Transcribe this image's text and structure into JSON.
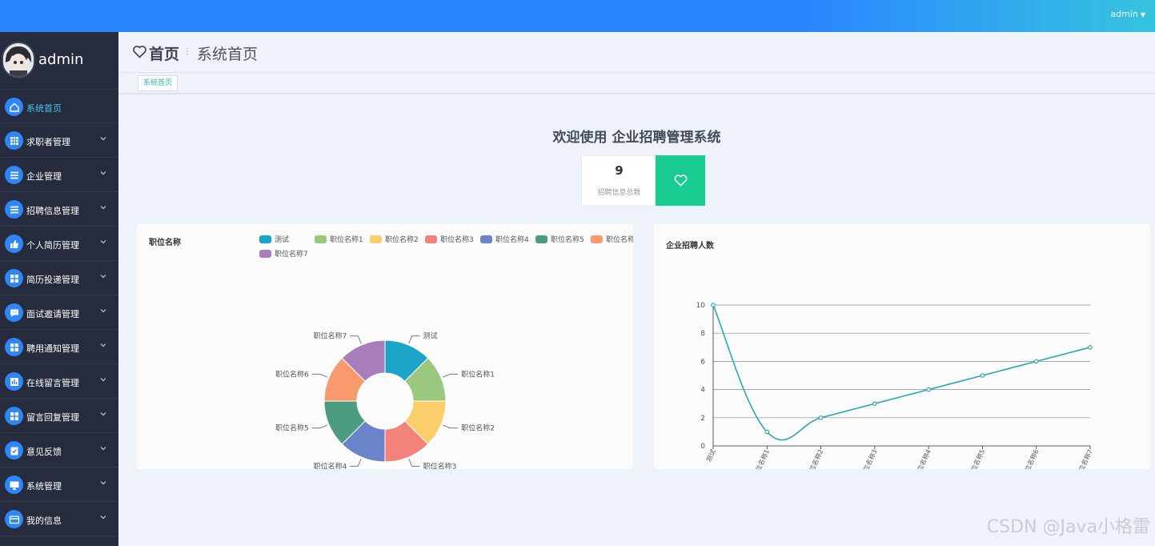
{
  "header": {
    "user": "admin"
  },
  "sidebar": {
    "username": "admin",
    "items": [
      {
        "label": "系统首页",
        "icon": "home-icon",
        "active": true,
        "has_arrow": false
      },
      {
        "label": "求职者管理",
        "icon": "grid-icon",
        "has_arrow": true
      },
      {
        "label": "企业管理",
        "icon": "list-icon",
        "has_arrow": true
      },
      {
        "label": "招聘信息管理",
        "icon": "list-icon",
        "has_arrow": true
      },
      {
        "label": "个人简历管理",
        "icon": "thumbs-up-icon",
        "has_arrow": true
      },
      {
        "label": "简历投递管理",
        "icon": "apps-icon",
        "has_arrow": true
      },
      {
        "label": "面试邀请管理",
        "icon": "message-icon",
        "has_arrow": true
      },
      {
        "label": "聘用通知管理",
        "icon": "apps-icon",
        "has_arrow": true
      },
      {
        "label": "在线留言管理",
        "icon": "chart-icon",
        "has_arrow": true
      },
      {
        "label": "留言回复管理",
        "icon": "apps-icon",
        "has_arrow": true
      },
      {
        "label": "意见反馈",
        "icon": "clipboard-icon",
        "has_arrow": true
      },
      {
        "label": "系统管理",
        "icon": "monitor-icon",
        "has_arrow": true
      },
      {
        "label": "我的信息",
        "icon": "card-icon",
        "has_arrow": true
      }
    ]
  },
  "page": {
    "title": "首页",
    "subtitle": "系统首页",
    "tab": "系统首页",
    "welcome": "欢迎使用 企业招聘管理系统",
    "stat": {
      "value": "9",
      "label": "招聘信息总数"
    }
  },
  "colors": {
    "accent": "#2a86ff",
    "sidebar_bg": "#262b3e",
    "stat_button": "#19cc92",
    "line": "#2aa6bd"
  },
  "watermark": "CSDN @Java小格雷",
  "chart_data": [
    {
      "type": "pie",
      "title": "职位名称",
      "donut": true,
      "legend_position": "top",
      "categories": [
        "测试",
        "职位名称1",
        "职位名称2",
        "职位名称3",
        "职位名称4",
        "职位名称5",
        "职位名称6",
        "职位名称7"
      ],
      "values": [
        1,
        1,
        1,
        1,
        1,
        1,
        1,
        1
      ],
      "colors": [
        "#1ba3c8",
        "#9bc77f",
        "#fbce6a",
        "#f3837a",
        "#6b83c9",
        "#4b9c80",
        "#f89a6c",
        "#a97dba"
      ]
    },
    {
      "type": "line",
      "title": "企业招聘人数",
      "smooth": true,
      "categories": [
        "测试",
        "职位名称1",
        "职位名称2",
        "职位名称3",
        "职位名称4",
        "职位名称5",
        "职位名称6",
        "职位名称7"
      ],
      "values": [
        10,
        1,
        2,
        3,
        4,
        5,
        6,
        7
      ],
      "ylim": [
        0,
        10
      ],
      "yticks": [
        0,
        2,
        4,
        6,
        8,
        10
      ],
      "grid": true
    }
  ]
}
